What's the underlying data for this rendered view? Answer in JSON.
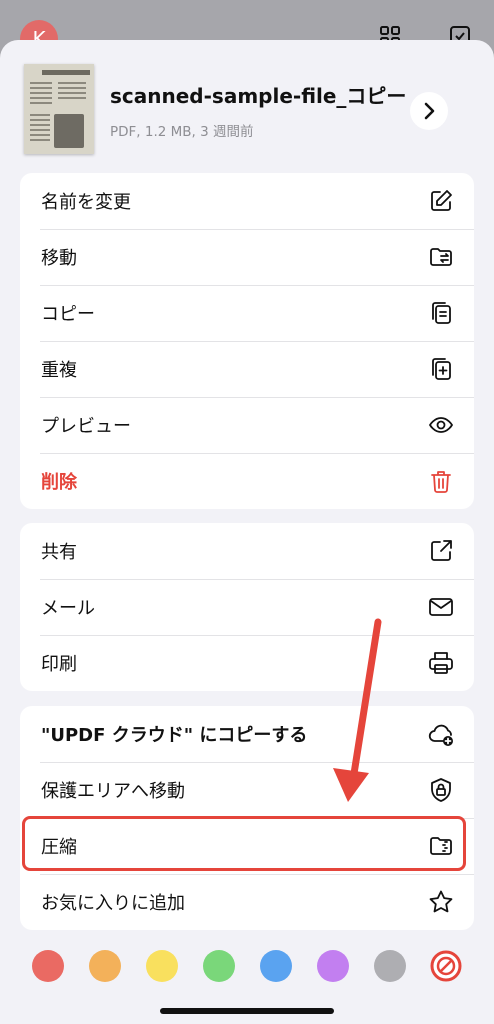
{
  "background": {
    "avatar_letter": "K"
  },
  "file": {
    "name": "scanned-sample-file_コピー",
    "meta": "PDF, 1.2 MB, 3 週間前"
  },
  "groups": [
    {
      "rows": [
        {
          "label": "名前を変更",
          "icon": "pencil-square-icon"
        },
        {
          "label": "移動",
          "icon": "folder-move-icon"
        },
        {
          "label": "コピー",
          "icon": "copy-docs-icon"
        },
        {
          "label": "重複",
          "icon": "duplicate-plus-icon"
        },
        {
          "label": "プレビュー",
          "icon": "eye-icon"
        },
        {
          "label": "削除",
          "icon": "trash-icon"
        }
      ]
    },
    {
      "rows": [
        {
          "label": "共有",
          "icon": "share-arrow-icon"
        },
        {
          "label": "メール",
          "icon": "envelope-icon"
        },
        {
          "label": "印刷",
          "icon": "printer-icon"
        }
      ]
    },
    {
      "rows": [
        {
          "label": "\"UPDF クラウド\" にコピーする",
          "icon": "cloud-plus-icon"
        },
        {
          "label": "保護エリアへ移動",
          "icon": "shield-lock-icon"
        },
        {
          "label": "圧縮",
          "icon": "zip-folder-icon"
        },
        {
          "label": "お気に入りに追加",
          "icon": "star-icon"
        }
      ]
    }
  ],
  "colors": {
    "danger": "#e5453b",
    "tags": [
      "#ea6a63",
      "#f3b15a",
      "#f9e05e",
      "#7ad77a",
      "#5aa3f0",
      "#c27ff0",
      "#aeaeb2"
    ],
    "no_color_icon": "no-color-icon"
  }
}
